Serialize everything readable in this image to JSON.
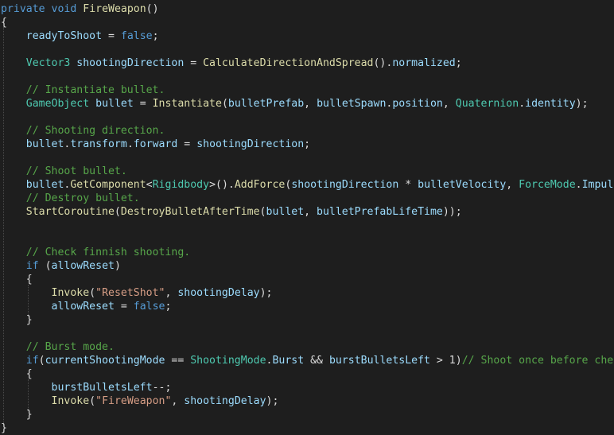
{
  "editor": {
    "language": "C#",
    "theme": {
      "background": "#1e1e1e",
      "keyword": "#569cd6",
      "type": "#4ec9b0",
      "method": "#dcdcaa",
      "variable": "#9cdcfe",
      "string": "#d69d85",
      "comment": "#57a64a",
      "plain": "#dcdcdc"
    },
    "lines": [
      [
        [
          "kw",
          "private"
        ],
        [
          "pl",
          " "
        ],
        [
          "kw",
          "void"
        ],
        [
          "pl",
          " "
        ],
        [
          "fn",
          "FireWeapon"
        ],
        [
          "pl",
          "()"
        ]
      ],
      [
        [
          "pl",
          "{"
        ]
      ],
      [
        [
          "pl",
          "    "
        ],
        [
          "var",
          "readyToShoot"
        ],
        [
          "pl",
          " = "
        ],
        [
          "kw",
          "false"
        ],
        [
          "pl",
          ";"
        ]
      ],
      [],
      [
        [
          "pl",
          "    "
        ],
        [
          "tp",
          "Vector3"
        ],
        [
          "pl",
          " "
        ],
        [
          "var",
          "shootingDirection"
        ],
        [
          "pl",
          " = "
        ],
        [
          "fn",
          "CalculateDirectionAndSpread"
        ],
        [
          "pl",
          "()."
        ],
        [
          "var",
          "normalized"
        ],
        [
          "pl",
          ";"
        ]
      ],
      [],
      [
        [
          "pl",
          "    "
        ],
        [
          "cm",
          "// Instantiate bullet."
        ]
      ],
      [
        [
          "pl",
          "    "
        ],
        [
          "tp",
          "GameObject"
        ],
        [
          "pl",
          " "
        ],
        [
          "var",
          "bullet"
        ],
        [
          "pl",
          " = "
        ],
        [
          "fn",
          "Instantiate"
        ],
        [
          "pl",
          "("
        ],
        [
          "var",
          "bulletPrefab"
        ],
        [
          "pl",
          ", "
        ],
        [
          "var",
          "bulletSpawn"
        ],
        [
          "pl",
          "."
        ],
        [
          "var",
          "position"
        ],
        [
          "pl",
          ", "
        ],
        [
          "tp",
          "Quaternion"
        ],
        [
          "pl",
          "."
        ],
        [
          "var",
          "identity"
        ],
        [
          "pl",
          ");"
        ]
      ],
      [],
      [
        [
          "pl",
          "    "
        ],
        [
          "cm",
          "// Shooting direction."
        ]
      ],
      [
        [
          "pl",
          "    "
        ],
        [
          "var",
          "bullet"
        ],
        [
          "pl",
          "."
        ],
        [
          "var",
          "transform"
        ],
        [
          "pl",
          "."
        ],
        [
          "var",
          "forward"
        ],
        [
          "pl",
          " = "
        ],
        [
          "var",
          "shootingDirection"
        ],
        [
          "pl",
          ";"
        ]
      ],
      [],
      [
        [
          "pl",
          "    "
        ],
        [
          "cm",
          "// Shoot bullet."
        ]
      ],
      [
        [
          "pl",
          "    "
        ],
        [
          "var",
          "bullet"
        ],
        [
          "pl",
          "."
        ],
        [
          "fn",
          "GetComponent"
        ],
        [
          "pl",
          "<"
        ],
        [
          "tp",
          "Rigidbody"
        ],
        [
          "pl",
          ">()."
        ],
        [
          "fn",
          "AddForce"
        ],
        [
          "pl",
          "("
        ],
        [
          "var",
          "shootingDirection"
        ],
        [
          "pl",
          " * "
        ],
        [
          "var",
          "bulletVelocity"
        ],
        [
          "pl",
          ", "
        ],
        [
          "tp",
          "ForceMode"
        ],
        [
          "pl",
          "."
        ],
        [
          "var",
          "Impulse"
        ],
        [
          "pl",
          ");"
        ]
      ],
      [
        [
          "pl",
          "    "
        ],
        [
          "cm",
          "// Destroy bullet."
        ]
      ],
      [
        [
          "pl",
          "    "
        ],
        [
          "fn",
          "StartCoroutine"
        ],
        [
          "pl",
          "("
        ],
        [
          "fn",
          "DestroyBulletAfterTime"
        ],
        [
          "pl",
          "("
        ],
        [
          "var",
          "bullet"
        ],
        [
          "pl",
          ", "
        ],
        [
          "var",
          "bulletPrefabLifeTime"
        ],
        [
          "pl",
          "));"
        ]
      ],
      [],
      [],
      [
        [
          "pl",
          "    "
        ],
        [
          "cm",
          "// Check finnish shooting."
        ]
      ],
      [
        [
          "pl",
          "    "
        ],
        [
          "kw",
          "if"
        ],
        [
          "pl",
          " ("
        ],
        [
          "var",
          "allowReset"
        ],
        [
          "pl",
          ")"
        ]
      ],
      [
        [
          "pl",
          "    {"
        ]
      ],
      [
        [
          "pl",
          "        "
        ],
        [
          "fn",
          "Invoke"
        ],
        [
          "pl",
          "("
        ],
        [
          "str",
          "\"ResetShot\""
        ],
        [
          "pl",
          ", "
        ],
        [
          "var",
          "shootingDelay"
        ],
        [
          "pl",
          ");"
        ]
      ],
      [
        [
          "pl",
          "        "
        ],
        [
          "var",
          "allowReset"
        ],
        [
          "pl",
          " = "
        ],
        [
          "kw",
          "false"
        ],
        [
          "pl",
          ";"
        ]
      ],
      [
        [
          "pl",
          "    }"
        ]
      ],
      [],
      [
        [
          "pl",
          "    "
        ],
        [
          "cm",
          "// Burst mode."
        ]
      ],
      [
        [
          "pl",
          "    "
        ],
        [
          "kw",
          "if"
        ],
        [
          "pl",
          "("
        ],
        [
          "var",
          "currentShootingMode"
        ],
        [
          "pl",
          " == "
        ],
        [
          "tp",
          "ShootingMode"
        ],
        [
          "pl",
          "."
        ],
        [
          "var",
          "Burst"
        ],
        [
          "pl",
          " && "
        ],
        [
          "var",
          "burstBulletsLeft"
        ],
        [
          "pl",
          " > 1)"
        ],
        [
          "cm",
          "// Shoot once before check;"
        ]
      ],
      [
        [
          "pl",
          "    {"
        ]
      ],
      [
        [
          "pl",
          "        "
        ],
        [
          "var",
          "burstBulletsLeft"
        ],
        [
          "pl",
          "--;"
        ]
      ],
      [
        [
          "pl",
          "        "
        ],
        [
          "fn",
          "Invoke"
        ],
        [
          "pl",
          "("
        ],
        [
          "str",
          "\"FireWeapon\""
        ],
        [
          "pl",
          ", "
        ],
        [
          "var",
          "shootingDelay"
        ],
        [
          "pl",
          ");"
        ]
      ],
      [
        [
          "pl",
          "    }"
        ]
      ],
      [
        [
          "pl",
          "}"
        ]
      ]
    ]
  }
}
